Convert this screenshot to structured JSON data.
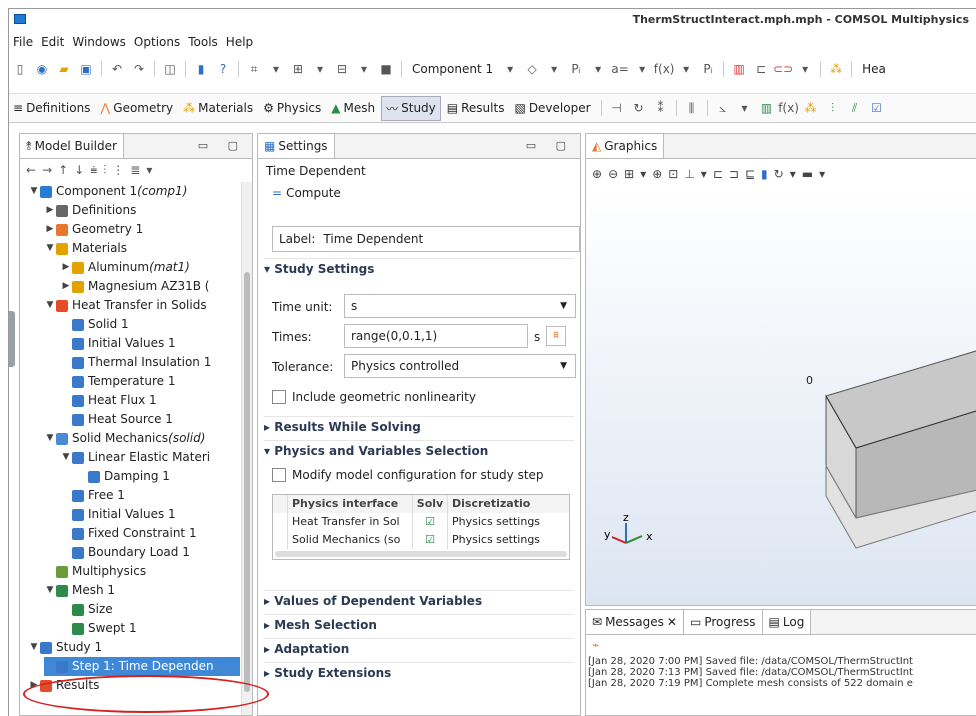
{
  "window": {
    "title": "ThermStructInteract.mph.mph - COMSOL Multiphysics"
  },
  "menu": [
    "File",
    "Edit",
    "Windows",
    "Options",
    "Tools",
    "Help"
  ],
  "toolbar": {
    "component_label": "Component 1",
    "heat_label": "Hea"
  },
  "ribbon_tabs": [
    {
      "label": "Definitions",
      "icon": "definitions-icon"
    },
    {
      "label": "Geometry",
      "icon": "geometry-icon"
    },
    {
      "label": "Materials",
      "icon": "materials-icon"
    },
    {
      "label": "Physics",
      "icon": "physics-icon"
    },
    {
      "label": "Mesh",
      "icon": "mesh-icon"
    },
    {
      "label": "Study",
      "icon": "study-icon",
      "active": true
    },
    {
      "label": "Results",
      "icon": "results-icon"
    },
    {
      "label": "Developer",
      "icon": "developer-icon"
    }
  ],
  "model_builder": {
    "tab_label": "Model Builder",
    "tree": [
      {
        "label": "Component 1 ",
        "italic": "(comp1)",
        "depth": 1,
        "arrow": "down",
        "color": "#2a7ad6"
      },
      {
        "label": "Definitions",
        "depth": 2,
        "arrow": "right",
        "color": "#666"
      },
      {
        "label": "Geometry 1",
        "depth": 2,
        "arrow": "right",
        "color": "#e8762d"
      },
      {
        "label": "Materials",
        "depth": 2,
        "arrow": "down",
        "color": "#e2a200"
      },
      {
        "label": "Aluminum ",
        "italic": "(mat1)",
        "depth": 3,
        "arrow": "right",
        "color": "#e2a200"
      },
      {
        "label": "Magnesium AZ31B (",
        "depth": 3,
        "arrow": "right",
        "color": "#e2a200"
      },
      {
        "label": "Heat Transfer in Solids",
        "depth": 2,
        "arrow": "down",
        "color": "#e24c2a"
      },
      {
        "label": "Solid 1",
        "depth": 3,
        "arrow": "",
        "color": "#3a78c9"
      },
      {
        "label": "Initial Values 1",
        "depth": 3,
        "arrow": "",
        "color": "#3a78c9"
      },
      {
        "label": "Thermal Insulation 1",
        "depth": 3,
        "arrow": "",
        "color": "#3a78c9"
      },
      {
        "label": "Temperature 1",
        "depth": 3,
        "arrow": "",
        "color": "#3a78c9"
      },
      {
        "label": "Heat Flux 1",
        "depth": 3,
        "arrow": "",
        "color": "#3a78c9"
      },
      {
        "label": "Heat Source 1",
        "depth": 3,
        "arrow": "",
        "color": "#3a78c9"
      },
      {
        "label": "Solid Mechanics ",
        "italic": "(solid)",
        "depth": 2,
        "arrow": "down",
        "color": "#4a8ad4"
      },
      {
        "label": "Linear Elastic Materi",
        "depth": 3,
        "arrow": "down",
        "color": "#3a78c9"
      },
      {
        "label": "Damping 1",
        "depth": 4,
        "arrow": "",
        "color": "#3a78c9"
      },
      {
        "label": "Free 1",
        "depth": 3,
        "arrow": "",
        "color": "#3a78c9"
      },
      {
        "label": "Initial Values 1",
        "depth": 3,
        "arrow": "",
        "color": "#3a78c9"
      },
      {
        "label": "Fixed Constraint 1",
        "depth": 3,
        "arrow": "",
        "color": "#3a78c9"
      },
      {
        "label": "Boundary Load 1",
        "depth": 3,
        "arrow": "",
        "color": "#3a78c9"
      },
      {
        "label": "Multiphysics",
        "depth": 2,
        "arrow": "",
        "color": "#6a9a3a"
      },
      {
        "label": "Mesh 1",
        "depth": 2,
        "arrow": "down",
        "color": "#2e8a4a"
      },
      {
        "label": "Size",
        "depth": 3,
        "arrow": "",
        "color": "#2e8a4a"
      },
      {
        "label": "Swept 1",
        "depth": 3,
        "arrow": "",
        "color": "#2e8a4a"
      },
      {
        "label": "Study 1",
        "depth": 1,
        "arrow": "down",
        "color": "#3a78c9"
      },
      {
        "label": "Step 1: Time Dependen",
        "depth": 2,
        "arrow": "",
        "color": "#3a78c9",
        "selected": true
      },
      {
        "label": "Results",
        "depth": 1,
        "arrow": "right",
        "color": "#e24c2a"
      }
    ]
  },
  "settings": {
    "tab_label": "Settings",
    "title": "Time Dependent",
    "compute_label": "Compute",
    "label_prefix": "Label:",
    "label_value": "Time Dependent",
    "study_settings": "Study Settings",
    "time_unit_label": "Time unit:",
    "time_unit_value": "s",
    "times_label": "Times:",
    "times_value": "range(0,0.1,1)",
    "times_unit": "s",
    "tolerance_label": "Tolerance:",
    "tolerance_value": "Physics controlled",
    "include_nonlin": "Include geometric nonlinearity",
    "results_while_solving": "Results While Solving",
    "physics_selection": "Physics and Variables Selection",
    "modify_config": "Modify model configuration for study step",
    "table_headers": [
      "Physics interface",
      "Solv",
      "Discretizatio"
    ],
    "table_rows": [
      [
        "Heat Transfer in Sol",
        "Physics settings"
      ],
      [
        "Solid Mechanics (so",
        "Physics settings"
      ]
    ],
    "values_dependent": "Values of Dependent Variables",
    "mesh_selection": "Mesh Selection",
    "adaptation": "Adaptation",
    "study_extensions": "Study Extensions"
  },
  "graphics": {
    "tab_label": "Graphics",
    "axis_y": "y",
    "axis_z": "z",
    "axis_x": "x",
    "origin_label": "0"
  },
  "messages": {
    "tabs": [
      "Messages",
      "Progress",
      "Log"
    ],
    "lines": [
      "[Jan 28, 2020 7:00 PM] Saved file: /data/COMSOL/ThermStructInt",
      "[Jan 28, 2020 7:13 PM] Saved file: /data/COMSOL/ThermStructInt",
      "[Jan 28, 2020 7:19 PM] Complete mesh consists of 522 domain e"
    ]
  }
}
